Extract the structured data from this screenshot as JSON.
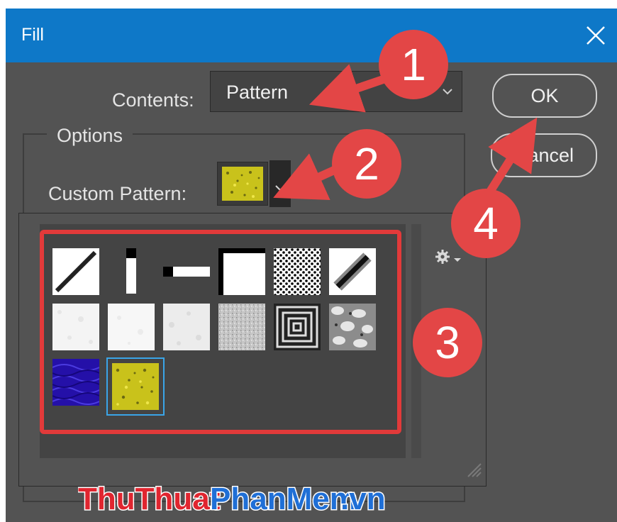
{
  "dialog": {
    "title": "Fill",
    "close_icon": "close-icon"
  },
  "contents": {
    "label": "Contents:",
    "value": "Pattern"
  },
  "options": {
    "legend": "Options",
    "custom_pattern_label": "Custom Pattern:"
  },
  "buttons": {
    "ok": "OK",
    "cancel": "Cancel"
  },
  "pattern_picker": {
    "patterns": [
      {
        "name": "diagonal-line",
        "selected": false
      },
      {
        "name": "vertical-bar",
        "selected": false
      },
      {
        "name": "horizontal-bar",
        "selected": false
      },
      {
        "name": "corner-frame",
        "selected": false
      },
      {
        "name": "dots",
        "selected": false
      },
      {
        "name": "diagonal-thick",
        "selected": false
      },
      {
        "name": "white-paper-1",
        "selected": false
      },
      {
        "name": "white-paper-2",
        "selected": false
      },
      {
        "name": "white-paper-3",
        "selected": false
      },
      {
        "name": "grey-noise",
        "selected": false
      },
      {
        "name": "concentric-squares",
        "selected": false
      },
      {
        "name": "grey-cloud",
        "selected": false
      },
      {
        "name": "blue-water",
        "selected": false
      },
      {
        "name": "yellow-granite",
        "selected": true
      }
    ],
    "settings_icon": "gear-icon"
  },
  "annotations": [
    "1",
    "2",
    "3",
    "4"
  ],
  "watermark": {
    "part1": "ThuThuat",
    "part2": "PhanMem",
    "part3": ".vn"
  },
  "colors": {
    "titlebar": "#0e78c8",
    "dialog_bg": "#535353",
    "highlight": "#e23a3a",
    "selected_outline": "#3aa5e8",
    "badge": "#e34646"
  }
}
